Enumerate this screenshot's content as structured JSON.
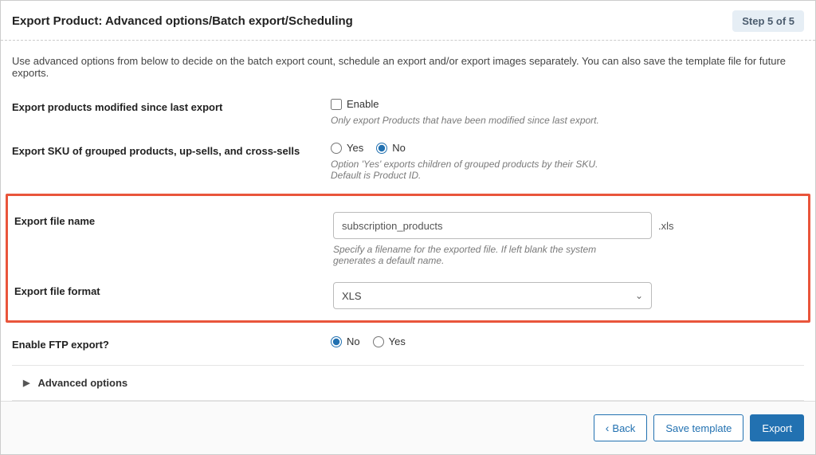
{
  "header": {
    "title": "Export Product: Advanced options/Batch export/Scheduling",
    "step": "Step 5 of 5"
  },
  "description": "Use advanced options from below to decide on the batch export count, schedule an export and/or export images separately. You can also save the template file for future exports.",
  "fields": {
    "modified_since": {
      "label": "Export products modified since last export",
      "checkbox_label": "Enable",
      "help": "Only export Products that have been modified since last export."
    },
    "export_sku": {
      "label": "Export SKU of grouped products, up-sells, and cross-sells",
      "yes": "Yes",
      "no": "No",
      "selected": "No",
      "help": "Option 'Yes' exports children of grouped products by their SKU. Default is Product ID."
    },
    "file_name": {
      "label": "Export file name",
      "value": "subscription_products",
      "extension": ".xls",
      "help": "Specify a filename for the exported file. If left blank the system generates a default name."
    },
    "file_format": {
      "label": "Export file format",
      "value": "XLS"
    },
    "ftp": {
      "label": "Enable FTP export?",
      "no": "No",
      "yes": "Yes",
      "selected": "No"
    }
  },
  "advanced_section": "Advanced options",
  "footer": {
    "back": "Back",
    "save": "Save template",
    "export": "Export"
  }
}
